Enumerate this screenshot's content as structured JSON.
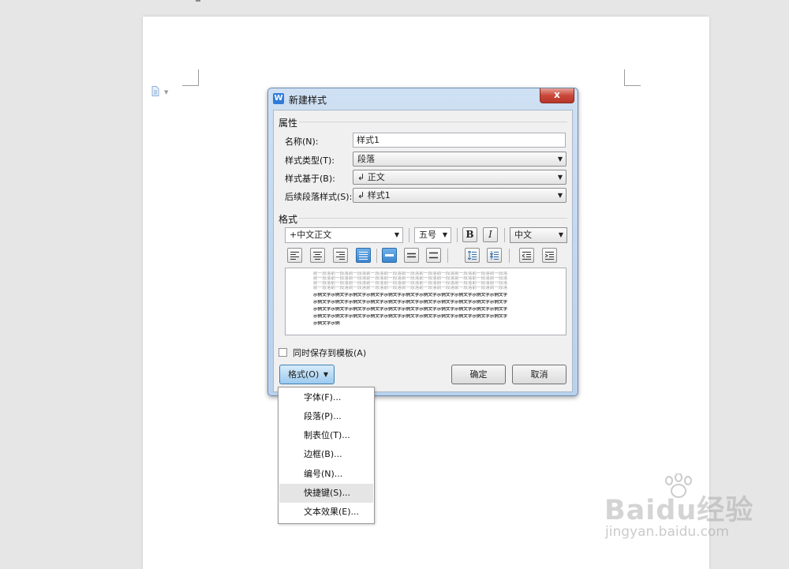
{
  "dialog": {
    "title": "新建样式",
    "close_symbol": "x",
    "app_icon_letter": "W",
    "properties_group": "属性",
    "name_label": "名称(N):",
    "name_value": "样式1",
    "type_label": "样式类型(T):",
    "type_value": "段落",
    "based_on_label": "样式基于(B):",
    "based_on_value": "↲ 正文",
    "following_label": "后续段落样式(S):",
    "following_value": "↲ 样式1",
    "format_group": "格式",
    "font_value": "+中文正文",
    "size_value": "五号",
    "bold_label": "B",
    "italic_label": "I",
    "lang_value": "中文",
    "preview_prev_text": "前一段落前一段落前一段落前一段落前一段落前一段落前一段落前一段落前一段落前一段落前一段落",
    "preview_sample_text": "示例文字示例文字示例文字示例文字示例文字示例文字示例文字示例文字示例文字示例文字示例文字",
    "preview_sample_tail": "示例文字示例",
    "save_to_template_label": "同时保存到模板(A)",
    "format_button": "格式(O)",
    "ok_button": "确定",
    "cancel_button": "取消"
  },
  "format_menu": {
    "items": [
      "字体(F)...",
      "段落(P)...",
      "制表位(T)...",
      "边框(B)...",
      "编号(N)...",
      "快捷键(S)...",
      "文本效果(E)..."
    ],
    "highlighted_index": 5
  },
  "watermark": {
    "brand": "Baidu经验",
    "url": "jingyan.baidu.com"
  },
  "colors": {
    "dialog_frame": "#b9d1ec",
    "close_button": "#c9483a",
    "format_button": "#9ccaef",
    "active_align": "#3b86cf",
    "menu_highlight": "#e5e5e5"
  }
}
